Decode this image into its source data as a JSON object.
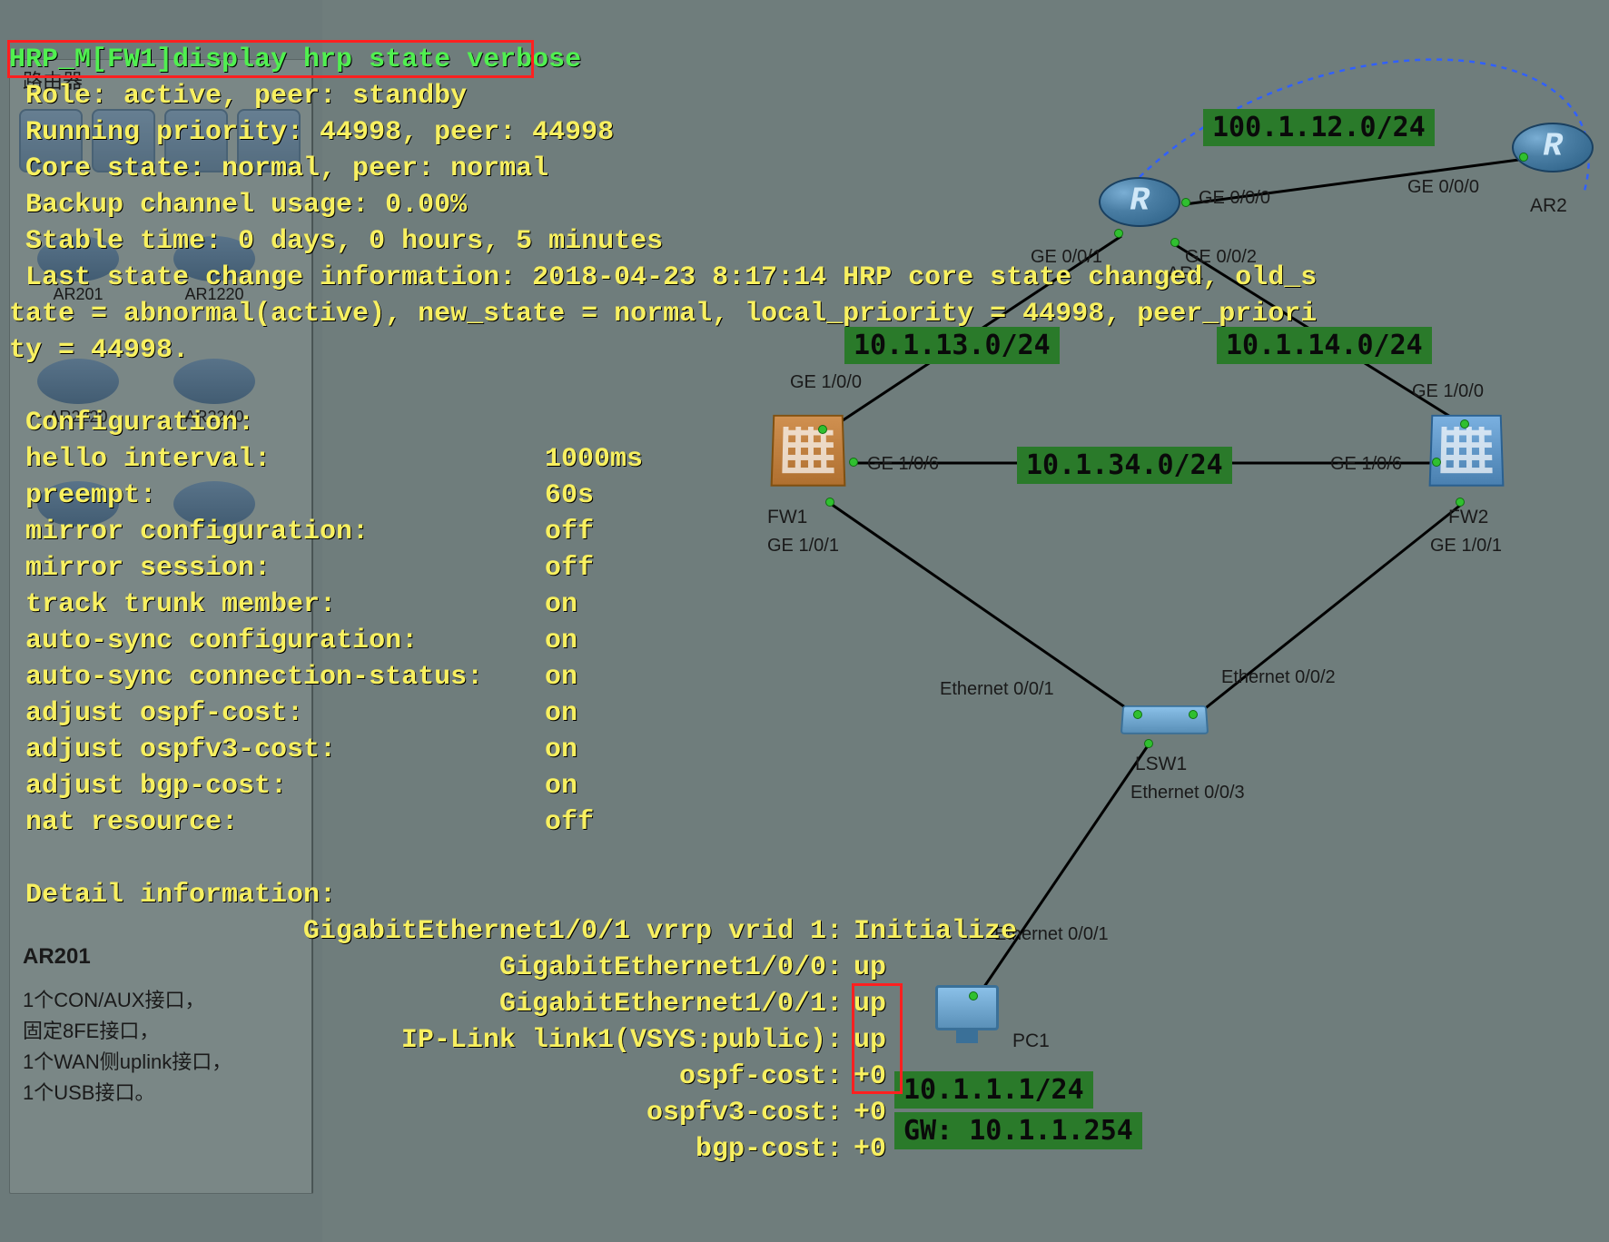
{
  "terminal": {
    "cmd": "HRP_M[FW1]display hrp state verbose",
    "role_line": " Role: active, peer: standby",
    "run_prio": " Running priority: 44998, peer: 44998",
    "core_state": " Core state: normal, peer: normal",
    "backup": " Backup channel usage: 0.00%",
    "stable": " Stable time: 0 days, 0 hours, 5 minutes",
    "last1": " Last state change information: 2018-04-23 8:17:14 HRP core state changed, old_s",
    "last2": "tate = abnormal(active), new_state = normal, local_priority = 44998, peer_priori",
    "last3": "ty = 44998.",
    "config_title": " Configuration:",
    "cfg": [
      {
        "k": " hello interval:",
        "v": "1000ms"
      },
      {
        "k": " preempt:",
        "v": "60s"
      },
      {
        "k": " mirror configuration:",
        "v": "off"
      },
      {
        "k": " mirror session:",
        "v": "off"
      },
      {
        "k": " track trunk member:",
        "v": "on"
      },
      {
        "k": " auto-sync configuration:",
        "v": "on"
      },
      {
        "k": " auto-sync connection-status:",
        "v": "on"
      },
      {
        "k": " adjust ospf-cost:",
        "v": "on"
      },
      {
        "k": " adjust ospfv3-cost:",
        "v": "on"
      },
      {
        "k": " adjust bgp-cost:",
        "v": "on"
      },
      {
        "k": " nat resource:",
        "v": "off"
      }
    ],
    "detail_title": " Detail information:",
    "details": [
      {
        "k": "GigabitEthernet1/0/1 vrrp vrid 1:",
        "v": "Initialize"
      },
      {
        "k": "GigabitEthernet1/0/0:",
        "v": "up"
      },
      {
        "k": "GigabitEthernet1/0/1:",
        "v": "up"
      },
      {
        "k": "IP-Link link1(VSYS:public):",
        "v": "up"
      },
      {
        "k": "ospf-cost:",
        "v": "+0"
      },
      {
        "k": "ospfv3-cost:",
        "v": "+0"
      },
      {
        "k": "bgp-cost:",
        "v": "+0"
      }
    ]
  },
  "sidebar": {
    "title": "路由器",
    "dev_labels": [
      "AR201",
      "AR1220",
      "AR2220",
      "AR2240"
    ],
    "pane_title": "AR201",
    "desc": [
      "1个CON/AUX接口，",
      "固定8FE接口，",
      "1个WAN侧uplink接口，",
      "1个USB接口。"
    ]
  },
  "topology": {
    "subnets": {
      "s_100_1_12": "100.1.12.0/24",
      "s_10_1_13": "10.1.13.0/24",
      "s_10_1_14": "10.1.14.0/24",
      "s_10_1_34": "10.1.34.0/24",
      "s_pc_ip": "10.1.1.1/24",
      "s_pc_gw": "GW: 10.1.1.254"
    },
    "devices": {
      "ar1": "AR1",
      "ar2": "AR2",
      "fw1": "FW1",
      "fw2": "FW2",
      "lsw1": "LSW1",
      "pc1": "PC1"
    },
    "ports": {
      "ar1_g000": "GE 0/0/0",
      "ar1_g001": "GE 0/0/1",
      "ar1_g002": "GE 0/0/2",
      "ar2_g000": "GE 0/0/0",
      "fw1_g100": "GE 1/0/0",
      "fw1_g106": "GE 1/0/6",
      "fw1_g101": "GE 1/0/1",
      "fw2_g100": "GE 1/0/0",
      "fw2_g106": "GE 1/0/6",
      "fw2_g101": "GE 1/0/1",
      "lsw_e001": "Ethernet 0/0/1",
      "lsw_e002": "Ethernet 0/0/2",
      "lsw_e003": "Ethernet 0/0/3",
      "pc_e001": "Ethernet 0/0/1"
    }
  }
}
